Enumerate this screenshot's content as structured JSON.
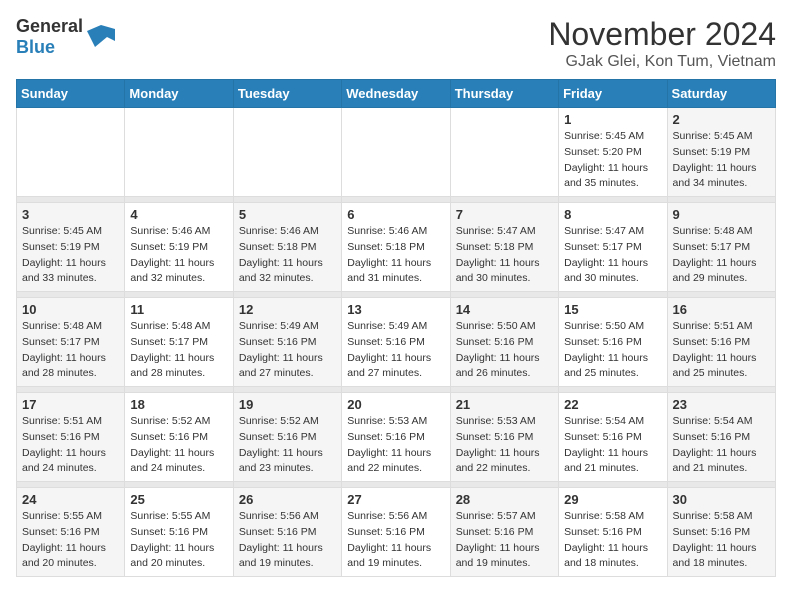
{
  "header": {
    "logo_general": "General",
    "logo_blue": "Blue",
    "month": "November 2024",
    "location": "GJak Glei, Kon Tum, Vietnam"
  },
  "weekdays": [
    "Sunday",
    "Monday",
    "Tuesday",
    "Wednesday",
    "Thursday",
    "Friday",
    "Saturday"
  ],
  "weeks": [
    [
      {
        "day": "",
        "sunrise": "",
        "sunset": "",
        "daylight": ""
      },
      {
        "day": "",
        "sunrise": "",
        "sunset": "",
        "daylight": ""
      },
      {
        "day": "",
        "sunrise": "",
        "sunset": "",
        "daylight": ""
      },
      {
        "day": "",
        "sunrise": "",
        "sunset": "",
        "daylight": ""
      },
      {
        "day": "",
        "sunrise": "",
        "sunset": "",
        "daylight": ""
      },
      {
        "day": "1",
        "sunrise": "Sunrise: 5:45 AM",
        "sunset": "Sunset: 5:20 PM",
        "daylight": "Daylight: 11 hours and 35 minutes."
      },
      {
        "day": "2",
        "sunrise": "Sunrise: 5:45 AM",
        "sunset": "Sunset: 5:19 PM",
        "daylight": "Daylight: 11 hours and 34 minutes."
      }
    ],
    [
      {
        "day": "3",
        "sunrise": "Sunrise: 5:45 AM",
        "sunset": "Sunset: 5:19 PM",
        "daylight": "Daylight: 11 hours and 33 minutes."
      },
      {
        "day": "4",
        "sunrise": "Sunrise: 5:46 AM",
        "sunset": "Sunset: 5:19 PM",
        "daylight": "Daylight: 11 hours and 32 minutes."
      },
      {
        "day": "5",
        "sunrise": "Sunrise: 5:46 AM",
        "sunset": "Sunset: 5:18 PM",
        "daylight": "Daylight: 11 hours and 32 minutes."
      },
      {
        "day": "6",
        "sunrise": "Sunrise: 5:46 AM",
        "sunset": "Sunset: 5:18 PM",
        "daylight": "Daylight: 11 hours and 31 minutes."
      },
      {
        "day": "7",
        "sunrise": "Sunrise: 5:47 AM",
        "sunset": "Sunset: 5:18 PM",
        "daylight": "Daylight: 11 hours and 30 minutes."
      },
      {
        "day": "8",
        "sunrise": "Sunrise: 5:47 AM",
        "sunset": "Sunset: 5:17 PM",
        "daylight": "Daylight: 11 hours and 30 minutes."
      },
      {
        "day": "9",
        "sunrise": "Sunrise: 5:48 AM",
        "sunset": "Sunset: 5:17 PM",
        "daylight": "Daylight: 11 hours and 29 minutes."
      }
    ],
    [
      {
        "day": "10",
        "sunrise": "Sunrise: 5:48 AM",
        "sunset": "Sunset: 5:17 PM",
        "daylight": "Daylight: 11 hours and 28 minutes."
      },
      {
        "day": "11",
        "sunrise": "Sunrise: 5:48 AM",
        "sunset": "Sunset: 5:17 PM",
        "daylight": "Daylight: 11 hours and 28 minutes."
      },
      {
        "day": "12",
        "sunrise": "Sunrise: 5:49 AM",
        "sunset": "Sunset: 5:16 PM",
        "daylight": "Daylight: 11 hours and 27 minutes."
      },
      {
        "day": "13",
        "sunrise": "Sunrise: 5:49 AM",
        "sunset": "Sunset: 5:16 PM",
        "daylight": "Daylight: 11 hours and 27 minutes."
      },
      {
        "day": "14",
        "sunrise": "Sunrise: 5:50 AM",
        "sunset": "Sunset: 5:16 PM",
        "daylight": "Daylight: 11 hours and 26 minutes."
      },
      {
        "day": "15",
        "sunrise": "Sunrise: 5:50 AM",
        "sunset": "Sunset: 5:16 PM",
        "daylight": "Daylight: 11 hours and 25 minutes."
      },
      {
        "day": "16",
        "sunrise": "Sunrise: 5:51 AM",
        "sunset": "Sunset: 5:16 PM",
        "daylight": "Daylight: 11 hours and 25 minutes."
      }
    ],
    [
      {
        "day": "17",
        "sunrise": "Sunrise: 5:51 AM",
        "sunset": "Sunset: 5:16 PM",
        "daylight": "Daylight: 11 hours and 24 minutes."
      },
      {
        "day": "18",
        "sunrise": "Sunrise: 5:52 AM",
        "sunset": "Sunset: 5:16 PM",
        "daylight": "Daylight: 11 hours and 24 minutes."
      },
      {
        "day": "19",
        "sunrise": "Sunrise: 5:52 AM",
        "sunset": "Sunset: 5:16 PM",
        "daylight": "Daylight: 11 hours and 23 minutes."
      },
      {
        "day": "20",
        "sunrise": "Sunrise: 5:53 AM",
        "sunset": "Sunset: 5:16 PM",
        "daylight": "Daylight: 11 hours and 22 minutes."
      },
      {
        "day": "21",
        "sunrise": "Sunrise: 5:53 AM",
        "sunset": "Sunset: 5:16 PM",
        "daylight": "Daylight: 11 hours and 22 minutes."
      },
      {
        "day": "22",
        "sunrise": "Sunrise: 5:54 AM",
        "sunset": "Sunset: 5:16 PM",
        "daylight": "Daylight: 11 hours and 21 minutes."
      },
      {
        "day": "23",
        "sunrise": "Sunrise: 5:54 AM",
        "sunset": "Sunset: 5:16 PM",
        "daylight": "Daylight: 11 hours and 21 minutes."
      }
    ],
    [
      {
        "day": "24",
        "sunrise": "Sunrise: 5:55 AM",
        "sunset": "Sunset: 5:16 PM",
        "daylight": "Daylight: 11 hours and 20 minutes."
      },
      {
        "day": "25",
        "sunrise": "Sunrise: 5:55 AM",
        "sunset": "Sunset: 5:16 PM",
        "daylight": "Daylight: 11 hours and 20 minutes."
      },
      {
        "day": "26",
        "sunrise": "Sunrise: 5:56 AM",
        "sunset": "Sunset: 5:16 PM",
        "daylight": "Daylight: 11 hours and 19 minutes."
      },
      {
        "day": "27",
        "sunrise": "Sunrise: 5:56 AM",
        "sunset": "Sunset: 5:16 PM",
        "daylight": "Daylight: 11 hours and 19 minutes."
      },
      {
        "day": "28",
        "sunrise": "Sunrise: 5:57 AM",
        "sunset": "Sunset: 5:16 PM",
        "daylight": "Daylight: 11 hours and 19 minutes."
      },
      {
        "day": "29",
        "sunrise": "Sunrise: 5:58 AM",
        "sunset": "Sunset: 5:16 PM",
        "daylight": "Daylight: 11 hours and 18 minutes."
      },
      {
        "day": "30",
        "sunrise": "Sunrise: 5:58 AM",
        "sunset": "Sunset: 5:16 PM",
        "daylight": "Daylight: 11 hours and 18 minutes."
      }
    ]
  ]
}
